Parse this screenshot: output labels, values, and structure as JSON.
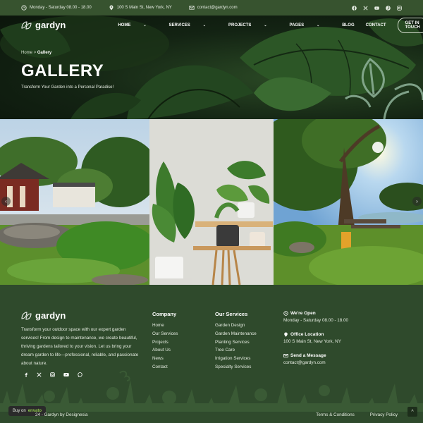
{
  "topbar": {
    "hours": "Monday - Saturday 08.00 - 18.00",
    "address": "100 S Main St, New York, NY",
    "email": "contact@gardyn.com",
    "socials": [
      "facebook-icon",
      "x-icon",
      "youtube-icon",
      "pinterest-icon",
      "instagram-icon"
    ]
  },
  "nav": {
    "brand": "gardyn",
    "items": [
      {
        "label": "HOME",
        "dropdown": true
      },
      {
        "label": "SERVICES",
        "dropdown": true
      },
      {
        "label": "PROJECTS",
        "dropdown": true
      },
      {
        "label": "PAGES",
        "dropdown": true
      },
      {
        "label": "BLOG",
        "dropdown": false
      },
      {
        "label": "CONTACT",
        "dropdown": false
      }
    ],
    "cta": "GET IN TOUCH"
  },
  "hero": {
    "breadcrumb_home": "Home",
    "breadcrumb_current": "Gallery",
    "title": "GALLERY",
    "subtitle": "Transform Your Garden into a Personal Paradise!"
  },
  "gallery": {
    "prev": "‹",
    "next": "›"
  },
  "footer": {
    "brand": "gardyn",
    "about": "Transform your outdoor space with our expert garden services! From design to maintenance, we create beautiful, thriving gardens tailored to your vision. Let us bring your dream garden to life—professional, reliable, and passionate about nature.",
    "socials": [
      "facebook-icon",
      "x-icon",
      "instagram-icon",
      "youtube-icon",
      "whatsapp-icon"
    ],
    "company": {
      "heading": "Company",
      "links": [
        "Home",
        "Our Services",
        "Projects",
        "About Us",
        "News",
        "Contact"
      ]
    },
    "services": {
      "heading": "Our Services",
      "links": [
        "Garden Design",
        "Garden Maintenance",
        "Planting Services",
        "Tree Care",
        "Irrigation Services",
        "Specialty Services"
      ]
    },
    "contact": {
      "open_label": "We're Open",
      "open_value": "Monday - Saturday 08.00 - 18.00",
      "office_label": "Office Location",
      "office_value": "100 S Main St, New York, NY",
      "send_label": "Send a Message",
      "send_value": "contact@gardyn.com"
    },
    "badge_prefix": "Buy on",
    "badge_brand": "envato",
    "copyright": "24 - Gardyn by Designesia",
    "terms": "Terms & Conditions",
    "privacy": "Privacy Policy",
    "totop": "^"
  },
  "colors": {
    "primary_green": "#2f4a2c",
    "topbar_green": "#37532f",
    "accent_leaf": "#8fb39a"
  }
}
